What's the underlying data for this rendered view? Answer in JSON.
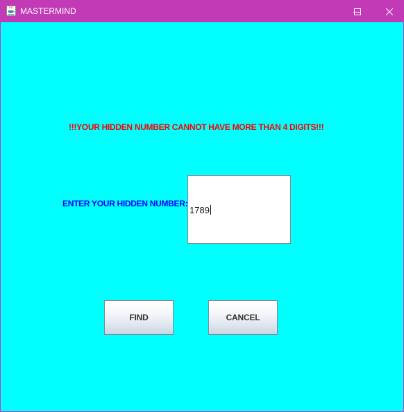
{
  "window": {
    "title": "MASTERMIND",
    "icon": "java-cup-icon",
    "title_bar_color": "#c33ab6",
    "controls": {
      "minimize": "minimize-icon",
      "maximize": "maximize-icon",
      "close": "close-icon"
    }
  },
  "content": {
    "background_color": "#00ffff",
    "warning_text": "!!!YOUR HIDDEN NUMBER CANNOT HAVE MORE THAN 4 DIGITS!!!",
    "warning_color": "#ff0000",
    "prompt_label": "ENTER YOUR HIDDEN NUMBER:",
    "prompt_color": "#0000ff",
    "hidden_number_value": "1789"
  },
  "buttons": {
    "find_label": "FIND",
    "cancel_label": "CANCEL"
  }
}
